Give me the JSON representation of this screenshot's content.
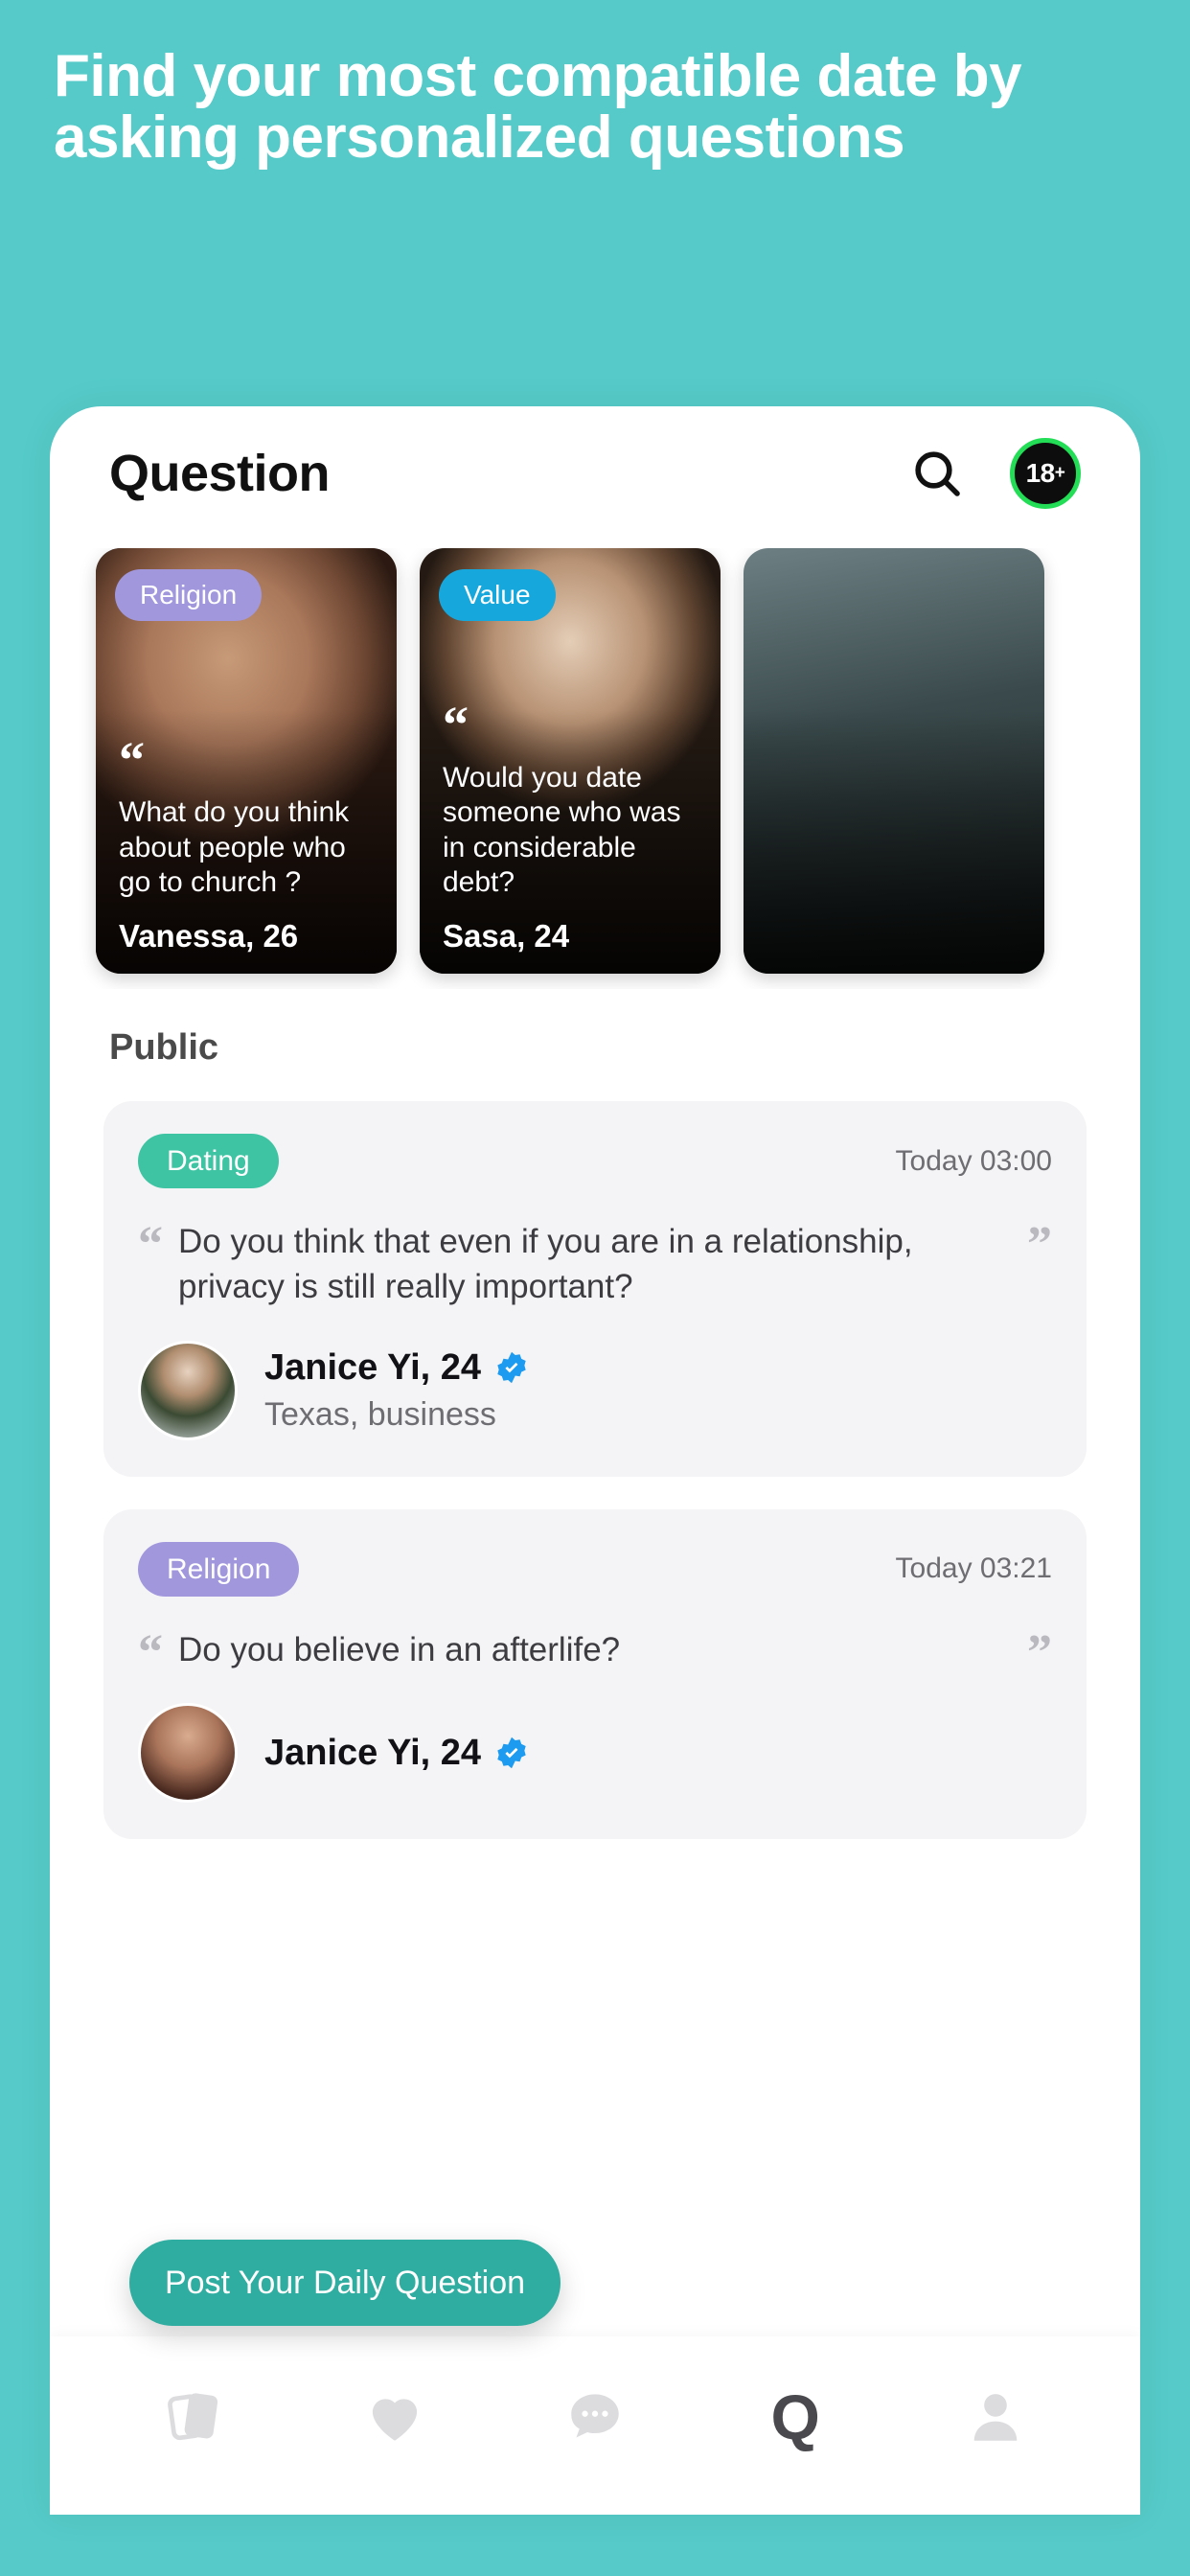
{
  "hero": {
    "headline": "Find your most compatible date by asking personalized questions",
    "background_color": "#55cac8"
  },
  "app": {
    "header": {
      "title": "Question",
      "search_icon": "search-icon",
      "age_badge": {
        "label": "18",
        "suffix": "+",
        "ring_color": "#22dd55",
        "fill_color": "#0d0d0d"
      }
    },
    "stories": [
      {
        "tag": "Religion",
        "tag_color": "#a197dd",
        "question": "What do you think about people who go to church ?",
        "name": "Vanessa, 26"
      },
      {
        "tag": "Value",
        "tag_color": "#16a8dd",
        "question": "Would you date someone who was in considerable debt?",
        "name": "Sasa, 24"
      },
      {
        "tag": "",
        "tag_color": "",
        "question": "",
        "name": ""
      }
    ],
    "public": {
      "section_title": "Public",
      "posts": [
        {
          "tag": "Dating",
          "tag_color": "#3ec4a3",
          "timestamp": "Today 03:00",
          "question": "Do you think that even if you are in a relationship, privacy is still really important?",
          "user": {
            "name": "Janice Yi, 24",
            "verified": true,
            "subtitle": "Texas, business"
          }
        },
        {
          "tag": "Religion",
          "tag_color": "#a197dd",
          "timestamp": "Today 03:21",
          "question": "Do you believe in an afterlife?",
          "user": {
            "name": "Janice Yi, 24",
            "verified": true,
            "subtitle": ""
          }
        }
      ]
    },
    "cta": {
      "label": "Post Your Daily Question",
      "color": "#2eada0"
    },
    "bottom_nav": {
      "items": [
        {
          "icon": "cards-icon",
          "active": false
        },
        {
          "icon": "heart-icon",
          "active": false
        },
        {
          "icon": "chat-bubble-icon",
          "active": false
        },
        {
          "icon": "question-q-icon",
          "label": "Q",
          "active": true
        },
        {
          "icon": "person-icon",
          "active": false
        }
      ]
    }
  }
}
